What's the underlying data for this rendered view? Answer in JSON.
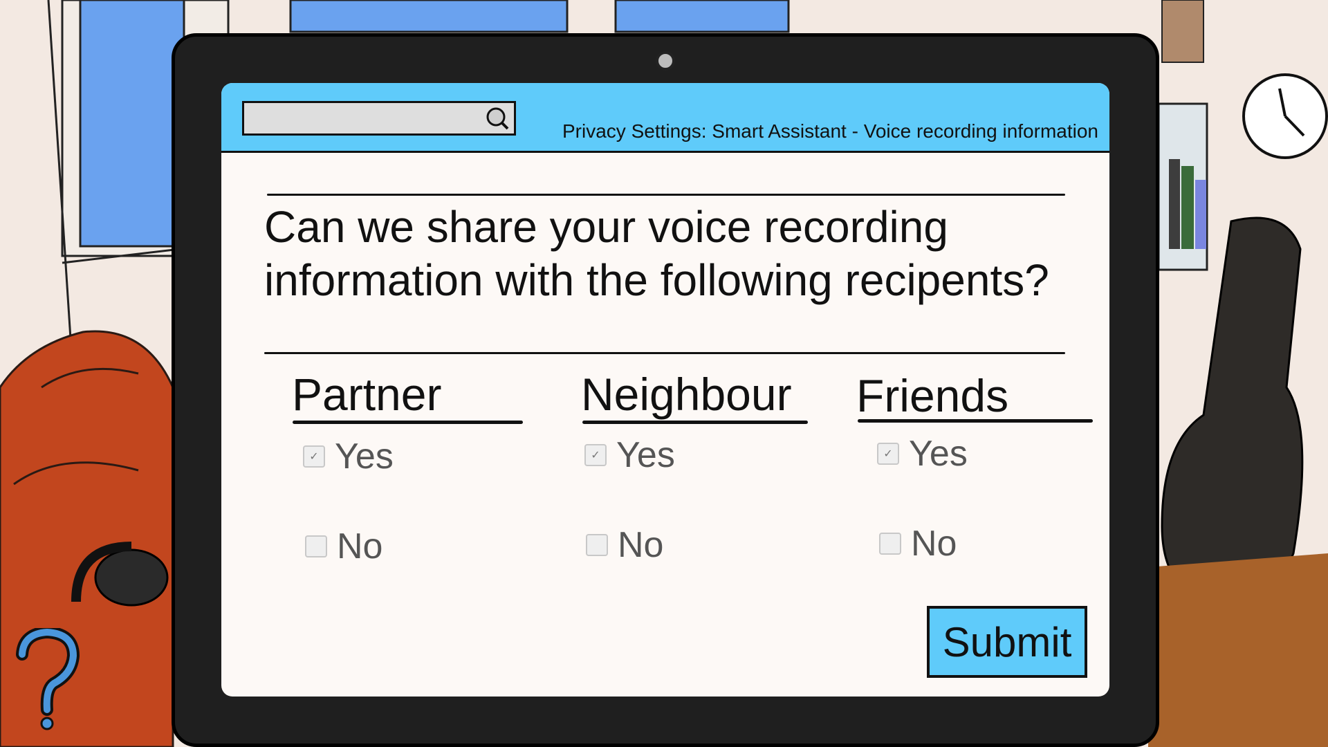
{
  "window": {
    "title": "Privacy Settings: Smart Assistant - Voice recording information",
    "search_value": ""
  },
  "form": {
    "question": "Can we share your voice recording information with the following recipents?",
    "columns": [
      {
        "label": "Partner",
        "yes": "Yes",
        "no": "No"
      },
      {
        "label": "Neighbour",
        "yes": "Yes",
        "no": "No"
      },
      {
        "label": "Friends",
        "yes": "Yes",
        "no": "No"
      }
    ],
    "submit_label": "Submit"
  },
  "icons": {
    "search": "search-icon",
    "camera": "camera-icon",
    "help": "question-mark-icon",
    "clock": "clock-icon"
  },
  "colors": {
    "accent": "#5fcbfa",
    "bezel": "#1f1f1f",
    "screen": "#fdf9f6"
  }
}
